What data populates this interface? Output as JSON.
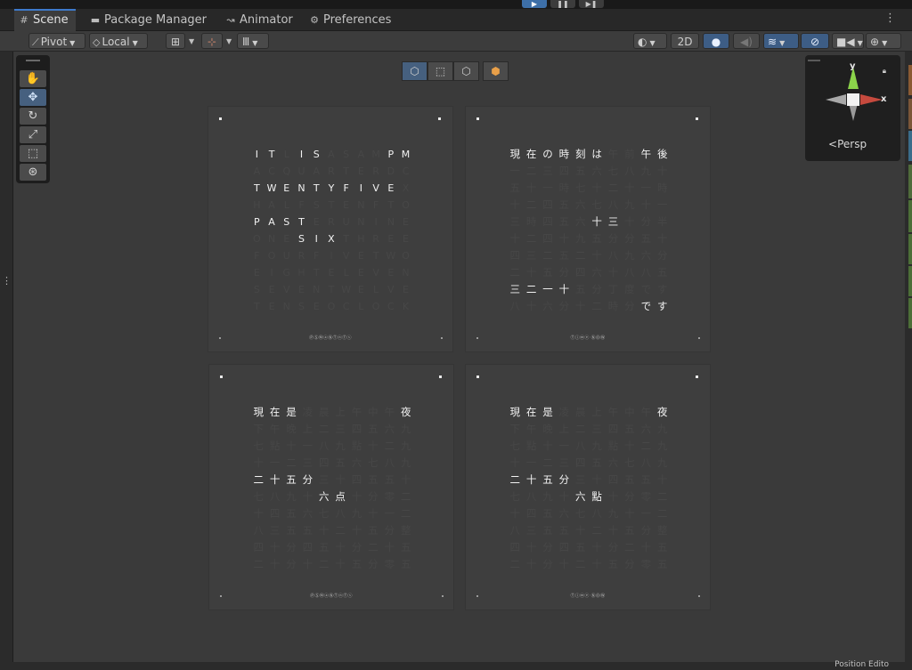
{
  "colors": {
    "accent": "#3d7acc",
    "active_tool": "#46607f",
    "lit_text": "#f2f2f2",
    "dim_text": "#474747"
  },
  "tabs": [
    {
      "label": "Scene",
      "icon": "grid-icon"
    },
    {
      "label": "Package Manager",
      "icon": "package-icon"
    },
    {
      "label": "Animator",
      "icon": "animator-icon"
    },
    {
      "label": "Preferences",
      "icon": "gear-icon"
    }
  ],
  "toolbar": {
    "pivot": "Pivot",
    "local": "Local",
    "mode_2d": "2D"
  },
  "gizmo": {
    "persp": "Persp",
    "y": "y",
    "x": "x"
  },
  "bottom_text": "Position Edito",
  "panels": [
    {
      "brand": "ⓅⓈⓂⓐⓃⓉⓝⓉⓢ",
      "rows": [
        {
          "chars": "ITLISASAMPM",
          "lit": [
            0,
            1,
            3,
            4,
            9,
            10
          ]
        },
        {
          "chars": "ACQUARTERDC",
          "lit": []
        },
        {
          "chars": "TWENTYFIVEX",
          "lit": [
            0,
            1,
            2,
            3,
            4,
            5,
            6,
            7,
            8,
            9
          ]
        },
        {
          "chars": "HALFSTENFTO",
          "lit": []
        },
        {
          "chars": "PASTERUNINE",
          "lit": [
            0,
            1,
            2,
            3
          ]
        },
        {
          "chars": "ONESIXTHREE",
          "lit": [
            3,
            4,
            5
          ]
        },
        {
          "chars": "FOURFIVETWO",
          "lit": []
        },
        {
          "chars": "EIGHTELEVEN",
          "lit": []
        },
        {
          "chars": "SEVENTWELVE",
          "lit": []
        },
        {
          "chars": "TENSEOCLOCK",
          "lit": []
        }
      ]
    },
    {
      "brand": "Ⓣⓘⓜⓔ ⓃⓄⓌ",
      "rows": [
        {
          "chars": "現在の時刻は午前午後",
          "lit": [
            0,
            1,
            2,
            3,
            4,
            5,
            8,
            9
          ]
        },
        {
          "chars": "一二三四五六七八九十",
          "lit": []
        },
        {
          "chars": "五十一時七十二十一時",
          "lit": []
        },
        {
          "chars": "十二四五六七八九十一",
          "lit": []
        },
        {
          "chars": "三時四五六十三十分半",
          "lit": [
            5,
            6
          ]
        },
        {
          "chars": "十二四十九五分分五十",
          "lit": []
        },
        {
          "chars": "四三二五二十八九六分",
          "lit": []
        },
        {
          "chars": "二十五分四六十八八五",
          "lit": []
        },
        {
          "chars": "三二一十五分丁度です",
          "lit": [
            0,
            1,
            2,
            3
          ]
        },
        {
          "chars": "八十六分十二時分です",
          "lit": [
            8,
            9
          ]
        }
      ]
    },
    {
      "brand": "ⓅⓈⓂⓐⓃⓉⓝⓉⓢ",
      "rows": [
        {
          "chars": "現在是凌晨上午中午夜",
          "lit": [
            0,
            1,
            2,
            9
          ]
        },
        {
          "chars": "下午晚上二三四五六九",
          "lit": []
        },
        {
          "chars": "七點十一八九點十二九",
          "lit": []
        },
        {
          "chars": "十一二三四五六七八九",
          "lit": []
        },
        {
          "chars": "二十五分三十四五五十",
          "lit": [
            0,
            1,
            2,
            3
          ]
        },
        {
          "chars": "七八九十六点十分零二",
          "lit": [
            4,
            5
          ]
        },
        {
          "chars": "十四五六七八九十一二",
          "lit": []
        },
        {
          "chars": "八三五五十二十五分整",
          "lit": []
        },
        {
          "chars": "四十分四五十分二十五",
          "lit": []
        },
        {
          "chars": "二十分十二十五分零五",
          "lit": []
        }
      ]
    },
    {
      "brand": "Ⓣⓘⓜⓔ ⓃⓄⓌ",
      "rows": [
        {
          "chars": "現在是凌晨上午中午夜",
          "lit": [
            0,
            1,
            2,
            9
          ]
        },
        {
          "chars": "下午晚上二三四五六九",
          "lit": []
        },
        {
          "chars": "七點十一八九點十二九",
          "lit": []
        },
        {
          "chars": "十一二三四五六七八九",
          "lit": []
        },
        {
          "chars": "二十五分三十四五五十",
          "lit": [
            0,
            1,
            2,
            3
          ]
        },
        {
          "chars": "七八九十六點十分零二",
          "lit": [
            4,
            5
          ]
        },
        {
          "chars": "十四五六七八九十一二",
          "lit": []
        },
        {
          "chars": "八三五五十二十五分整",
          "lit": []
        },
        {
          "chars": "四十分四五十分二十五",
          "lit": []
        },
        {
          "chars": "二十分十二十五分零五",
          "lit": []
        }
      ]
    }
  ]
}
